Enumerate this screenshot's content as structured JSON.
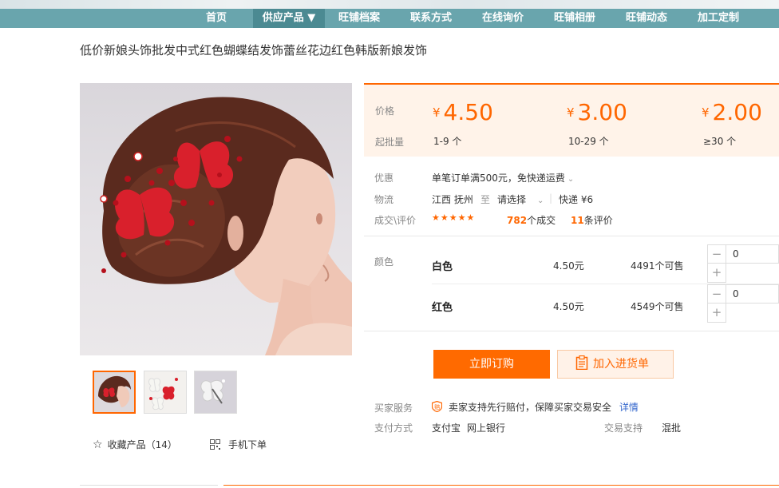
{
  "nav": {
    "items": [
      "首页",
      "供应产品 ▼",
      "旺铺档案",
      "联系方式",
      "在线询价",
      "旺铺相册",
      "旺铺动态",
      "加工定制"
    ]
  },
  "product": {
    "title": "低价新娘头饰批发中式红色蝴蝶结发饰蕾丝花边红色韩版新娘发饰"
  },
  "gallery": {
    "favorite_label": "收藏产品（14）",
    "mobile_label": "手机下单"
  },
  "pricing": {
    "price_label": "价格",
    "moq_label": "起批量",
    "currency": "¥",
    "tiers": [
      {
        "price": "4.50",
        "moq": "1-9 个"
      },
      {
        "price": "3.00",
        "moq": "10-29 个"
      },
      {
        "price": "2.00",
        "moq": "≥30 个"
      }
    ]
  },
  "info": {
    "promo_label": "优惠",
    "promo_text": "单笔订单满500元，免快递运费",
    "logistics_label": "物流",
    "origin": "江西 抚州",
    "to": "至",
    "destination": "请选择",
    "shipping": "快递 ¥6",
    "deals_label": "成交\\评价",
    "stars": "★★★★★",
    "deals_count": "782",
    "deals_suffix": "个成交",
    "reviews_count": "11",
    "reviews_suffix": "条评价"
  },
  "sku": {
    "color_label": "颜色",
    "options": [
      {
        "name": "白色",
        "price": "4.50元",
        "stock": "4491个可售",
        "qty": "0"
      },
      {
        "name": "红色",
        "price": "4.50元",
        "stock": "4549个可售",
        "qty": "0"
      }
    ]
  },
  "actions": {
    "buy_label": "立即订购",
    "cart_label": "加入进货单"
  },
  "service": {
    "buyer_service_label": "买家服务",
    "buyer_service_text": "卖家支持先行赔付，保障买家交易安全",
    "details_link": "详情",
    "payment_label": "支付方式",
    "payment_1": "支付宝",
    "payment_2": "网上银行",
    "trade_label": "交易支持",
    "trade_value": "混批"
  },
  "colors": {
    "nav_bg": "#69a5ad",
    "accent": "#ff6a00",
    "price_bg": "#fff3e9"
  }
}
